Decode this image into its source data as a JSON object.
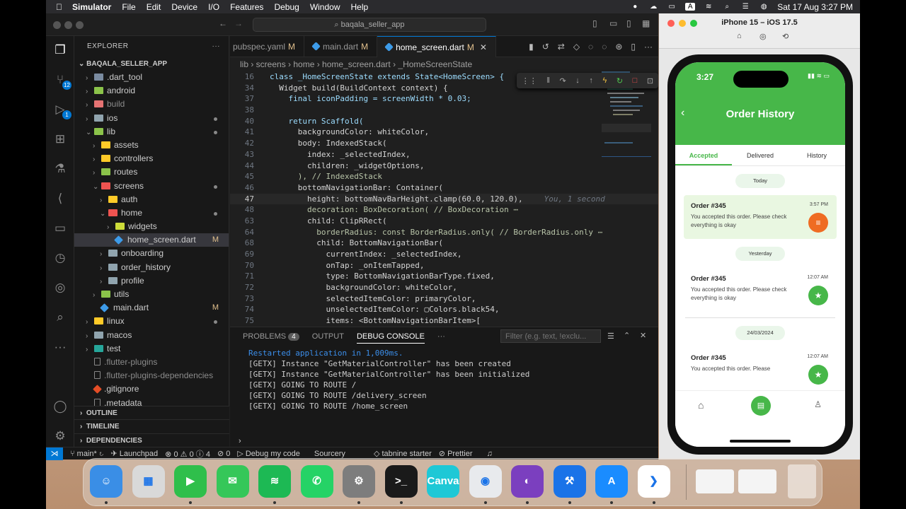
{
  "menubar": {
    "apple": "",
    "app": "Simulator",
    "items": [
      "File",
      "Edit",
      "Device",
      "I/O",
      "Features",
      "Debug",
      "Window",
      "Help"
    ],
    "datetime": "Sat 17 Aug  3:27 PM"
  },
  "vscode": {
    "search": "baqala_seller_app",
    "activity_badges": {
      "scm": "12",
      "debug": "1"
    },
    "explorer": {
      "header": "EXPLORER",
      "root": "BAQALA_SELLER_APP",
      "rows": [
        {
          "label": ".dart_tool",
          "depth": 1,
          "kind": "folder",
          "color": "#7a8ba0"
        },
        {
          "label": "android",
          "depth": 1,
          "kind": "folder",
          "color": "#8bc34a"
        },
        {
          "label": "build",
          "depth": 1,
          "kind": "folder",
          "color": "#e57373",
          "muted": true
        },
        {
          "label": "ios",
          "depth": 1,
          "kind": "folder",
          "color": "#90a4ae",
          "dot": true
        },
        {
          "label": "lib",
          "depth": 1,
          "kind": "folder-open",
          "color": "#8bc34a",
          "dot": true
        },
        {
          "label": "assets",
          "depth": 2,
          "kind": "folder",
          "color": "#ffca28"
        },
        {
          "label": "controllers",
          "depth": 2,
          "kind": "folder",
          "color": "#ffca28"
        },
        {
          "label": "routes",
          "depth": 2,
          "kind": "folder",
          "color": "#8bc34a"
        },
        {
          "label": "screens",
          "depth": 2,
          "kind": "folder-open",
          "color": "#ef5350",
          "dot": true
        },
        {
          "label": "auth",
          "depth": 3,
          "kind": "folder",
          "color": "#ffca28"
        },
        {
          "label": "home",
          "depth": 3,
          "kind": "folder-open",
          "color": "#ef5350",
          "dot": true
        },
        {
          "label": "widgets",
          "depth": 4,
          "kind": "folder",
          "color": "#cddc39"
        },
        {
          "label": "home_screen.dart",
          "depth": 4,
          "kind": "dart",
          "mark": "M",
          "selected": true
        },
        {
          "label": "onboarding",
          "depth": 3,
          "kind": "folder",
          "color": "#90a4ae"
        },
        {
          "label": "order_history",
          "depth": 3,
          "kind": "folder",
          "color": "#90a4ae"
        },
        {
          "label": "profile",
          "depth": 3,
          "kind": "folder",
          "color": "#90a4ae"
        },
        {
          "label": "utils",
          "depth": 2,
          "kind": "folder",
          "color": "#8bc34a"
        },
        {
          "label": "main.dart",
          "depth": 2,
          "kind": "dart",
          "mark": "M"
        },
        {
          "label": "linux",
          "depth": 1,
          "kind": "folder",
          "color": "#ffca28",
          "dot": true
        },
        {
          "label": "macos",
          "depth": 1,
          "kind": "folder",
          "color": "#90a4ae"
        },
        {
          "label": "test",
          "depth": 1,
          "kind": "folder",
          "color": "#26a69a"
        },
        {
          "label": ".flutter-plugins",
          "depth": 1,
          "kind": "file",
          "muted": true
        },
        {
          "label": ".flutter-plugins-dependencies",
          "depth": 1,
          "kind": "file",
          "muted": true
        },
        {
          "label": ".gitignore",
          "depth": 1,
          "kind": "git"
        },
        {
          "label": ".metadata",
          "depth": 1,
          "kind": "file"
        }
      ]
    },
    "panels": [
      "OUTLINE",
      "TIMELINE",
      "DEPENDENCIES"
    ],
    "tabs": [
      {
        "label": "pubspec.yaml",
        "mark": "M"
      },
      {
        "label": "main.dart",
        "mark": "M"
      },
      {
        "label": "home_screen.dart",
        "mark": "M",
        "active": true
      }
    ],
    "breadcrumb": "lib › screens › home › home_screen.dart › _HomeScreenState",
    "code": [
      {
        "n": "16",
        "t": "class _HomeScreenState extends State<HomeScreen> {"
      },
      {
        "n": "34",
        "t": "  Widget build(BuildContext context) {"
      },
      {
        "n": "37",
        "t": "    final iconPadding = screenWidth * 0.03;"
      },
      {
        "n": "38",
        "t": ""
      },
      {
        "n": "40",
        "t": "    return Scaffold("
      },
      {
        "n": "41",
        "t": "      backgroundColor: whiteColor,"
      },
      {
        "n": "42",
        "t": "      body: IndexedStack("
      },
      {
        "n": "43",
        "t": "        index: _selectedIndex,"
      },
      {
        "n": "44",
        "t": "        children: _widgetOptions,"
      },
      {
        "n": "45",
        "t": "      ), // IndexedStack"
      },
      {
        "n": "46",
        "t": "      bottomNavigationBar: Container("
      },
      {
        "n": "47",
        "t": "        height: bottomNavBarHeight.clamp(60.0, 120.0),",
        "ghost": "You, 1 second"
      },
      {
        "n": "48",
        "t": "        decoration: BoxDecoration( // BoxDecoration ⋯"
      },
      {
        "n": "63",
        "t": "        child: ClipRRect("
      },
      {
        "n": "64",
        "t": "          borderRadius: const BorderRadius.only( // BorderRadius.only ⋯"
      },
      {
        "n": "68",
        "t": "          child: BottomNavigationBar("
      },
      {
        "n": "69",
        "t": "            currentIndex: _selectedIndex,"
      },
      {
        "n": "70",
        "t": "            onTap: _onItemTapped,"
      },
      {
        "n": "71",
        "t": "            type: BottomNavigationBarType.fixed,"
      },
      {
        "n": "72",
        "t": "            backgroundColor: whiteColor,"
      },
      {
        "n": "73",
        "t": "            selectedItemColor: primaryColor,"
      },
      {
        "n": "74",
        "t": "            unselectedItemColor: ▢Colors.black54,"
      },
      {
        "n": "75",
        "t": "            items: <BottomNavigationBarItem>["
      }
    ],
    "panel_tabs": {
      "problems": "PROBLEMS",
      "problems_count": "4",
      "output": "OUTPUT",
      "debug": "DEBUG CONSOLE",
      "more": "···"
    },
    "filter_placeholder": "Filter (e.g. text, !exclu...",
    "console": [
      {
        "t": "Restarted application in 1,009ms.",
        "blue": true
      },
      {
        "t": "[GETX] Instance \"GetMaterialController\" has been created"
      },
      {
        "t": "[GETX] Instance \"GetMaterialController\" has been initialized"
      },
      {
        "t": "[GETX] GOING TO ROUTE /"
      },
      {
        "t": "[GETX] GOING TO ROUTE /delivery_screen"
      },
      {
        "t": "[GETX] GOING TO ROUTE /home_screen"
      }
    ],
    "status": {
      "branch": "main*",
      "launchpad": "Launchpad",
      "errors": "0",
      "warnings": "0",
      "info": "4",
      "ports": "0",
      "debug": "Debug my code",
      "sourcery": "Sourcery",
      "tabnine": "tabnine starter",
      "prettier": "Prettier"
    }
  },
  "simulator": {
    "title": "iPhone 15 – iOS 17.5",
    "phone": {
      "time": "3:27",
      "title": "Order History",
      "tabs": [
        "Accepted",
        "Delivered",
        "History"
      ],
      "groups": [
        {
          "date": "Today",
          "order": "Order #345",
          "time": "3:57 PM",
          "desc": "You accepted this order. Please check everything is okay",
          "highlight": true,
          "btn_color": "#ef6c23",
          "btn_icon": "≡"
        },
        {
          "date": "Yesterday",
          "order": "Order #345",
          "time": "12:07 AM",
          "desc": "You accepted this order. Please check everything is okay",
          "highlight": false,
          "btn_color": "#47b749",
          "btn_icon": "★"
        },
        {
          "date": "24/03/2024",
          "order": "Order #345",
          "time": "12:07 AM",
          "desc": "You accepted this order. Please",
          "highlight": false,
          "btn_color": "#47b749",
          "btn_icon": "★"
        }
      ]
    }
  },
  "dock": {
    "apps": [
      {
        "name": "finder",
        "label": "☺",
        "color": "#3a8ee6"
      },
      {
        "name": "launchpad",
        "label": "▦",
        "color": "#d9d9d9"
      },
      {
        "name": "facetime",
        "label": "▶",
        "color": "#2fbf4b"
      },
      {
        "name": "messages",
        "label": "✉",
        "color": "#35c759"
      },
      {
        "name": "spotify",
        "label": "≋",
        "color": "#1db954"
      },
      {
        "name": "whatsapp",
        "label": "✆",
        "color": "#25d366"
      },
      {
        "name": "system-settings",
        "label": "⚙",
        "color": "#7d7d7d"
      },
      {
        "name": "terminal",
        "label": ">_",
        "color": "#1a1a1a"
      },
      {
        "name": "canva",
        "label": "Canva",
        "color": "#1ec8d6"
      },
      {
        "name": "chrome",
        "label": "◉",
        "color": "#e8eaed"
      },
      {
        "name": "github-desktop",
        "label": "◐",
        "color": "#7b3fbf"
      },
      {
        "name": "xcode",
        "label": "⚒",
        "color": "#1a73e8"
      },
      {
        "name": "simulator",
        "label": "A",
        "color": "#1a8cff"
      },
      {
        "name": "vscode",
        "label": "❯",
        "color": "#ffffff"
      }
    ]
  }
}
